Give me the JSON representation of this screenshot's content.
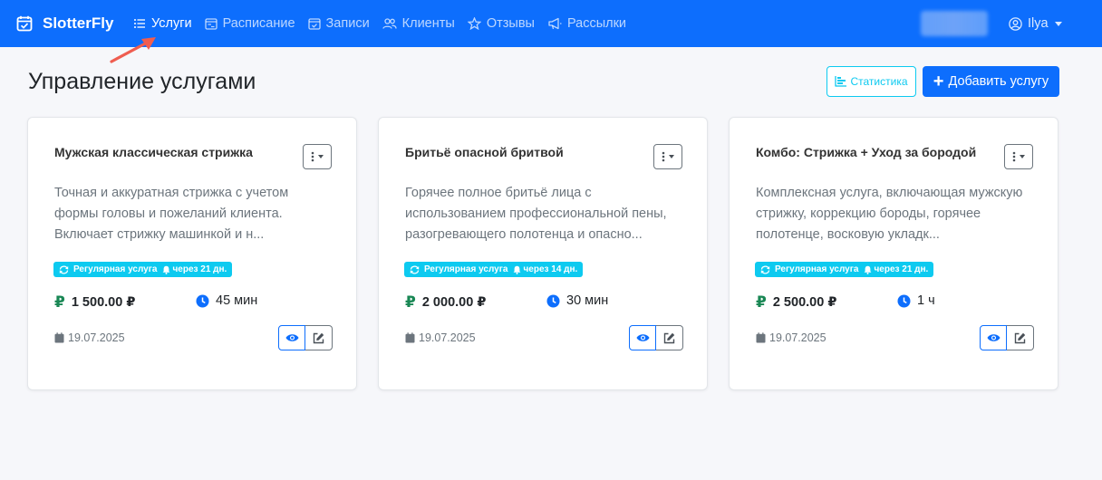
{
  "navbar": {
    "brand": "SlotterFly",
    "items": [
      {
        "label": "Услуги",
        "icon": "list-icon",
        "active": true
      },
      {
        "label": "Расписание",
        "icon": "calendar-range-icon"
      },
      {
        "label": "Записи",
        "icon": "calendar-check-icon"
      },
      {
        "label": "Клиенты",
        "icon": "people-icon"
      },
      {
        "label": "Отзывы",
        "icon": "star-icon"
      },
      {
        "label": "Рассылки",
        "icon": "megaphone-icon"
      }
    ],
    "user": "Ilya"
  },
  "header": {
    "title": "Управление услугами",
    "stats_label": "Статистика",
    "add_label": "Добавить услугу"
  },
  "colors": {
    "primary": "#0d6efd",
    "info": "#0dcaf0",
    "success": "#198754",
    "annotation": "#ef5d50"
  },
  "services": [
    {
      "title": "Мужская классическая стрижка",
      "description": "Точная и аккуратная стрижка с учетом формы головы и пожеланий клиента. Включает стрижку машинкой и н...",
      "badge_type": "Регулярная услуга",
      "badge_interval": "через 21 дн.",
      "price": "1 500.00 ₽",
      "duration": "45 мин",
      "date": "19.07.2025"
    },
    {
      "title": "Бритьё опасной бритвой",
      "description": "Горячее полное бритьё лица с использованием профессиональной пены, разогревающего полотенца и опасно...",
      "badge_type": "Регулярная услуга",
      "badge_interval": "через 14 дн.",
      "price": "2 000.00 ₽",
      "duration": "30 мин",
      "date": "19.07.2025"
    },
    {
      "title": "Комбо: Стрижка + Уход за бородой",
      "description": "Комплексная услуга, включающая мужскую стрижку, коррекцию бороды, горячее полотенце, восковую укладк...",
      "badge_type": "Регулярная услуга",
      "badge_interval": "через 21 дн.",
      "price": "2 500.00 ₽",
      "duration": "1 ч",
      "date": "19.07.2025"
    }
  ],
  "currency_symbol": "₽"
}
